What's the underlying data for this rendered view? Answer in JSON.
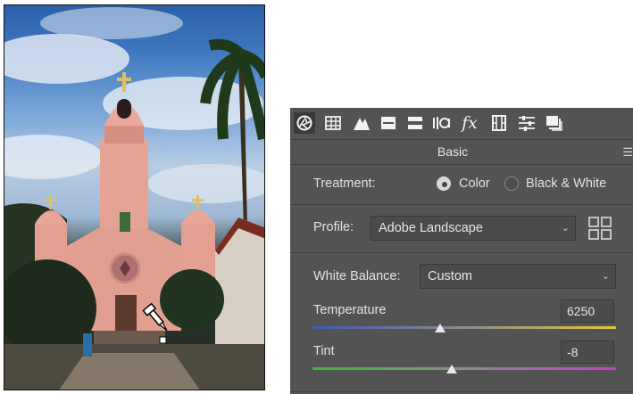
{
  "panel": {
    "title": "Basic",
    "menu_icon": "panel-menu-icon",
    "tool_icons": [
      "aperture-icon",
      "grid-icon",
      "tone-curve-icon",
      "hsl-icon",
      "split-toning-icon",
      "detail-icon",
      "fx-icon",
      "film-strip-icon",
      "sliders-icon",
      "stack-icon"
    ]
  },
  "treatment": {
    "label": "Treatment:",
    "option_color": "Color",
    "option_bw": "Black & White",
    "selected": "Color"
  },
  "profile": {
    "label": "Profile:",
    "value": "Adobe Landscape"
  },
  "white_balance": {
    "label": "White Balance:",
    "value": "Custom"
  },
  "temperature": {
    "label": "Temperature",
    "value": "6250",
    "slider_fraction": 0.42
  },
  "tint": {
    "label": "Tint",
    "value": "-8",
    "slider_fraction": 0.46
  },
  "colors": {
    "panel_bg": "#535353",
    "temp_start": "#3f57b8",
    "temp_end": "#e0c53a",
    "tint_start": "#3fb83a",
    "tint_end": "#c43fc8"
  }
}
